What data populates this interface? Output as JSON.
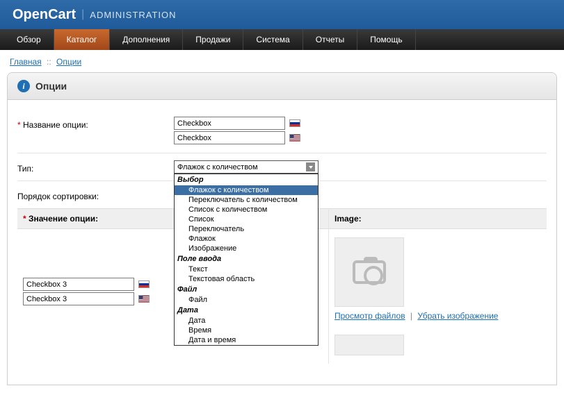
{
  "header": {
    "logo": "OpenCart",
    "sub": "ADMINISTRATION"
  },
  "menu": {
    "items": [
      "Обзор",
      "Каталог",
      "Дополнения",
      "Продажи",
      "Система",
      "Отчеты",
      "Помощь"
    ],
    "active_index": 1
  },
  "breadcrumb": {
    "home": "Главная",
    "current": "Опции"
  },
  "panel": {
    "title": "Опции"
  },
  "form": {
    "name_label": "Название опции:",
    "name_ru": "Checkbox",
    "name_en": "Checkbox",
    "type_label": "Тип:",
    "type_selected": "Флажок с количеством",
    "sort_label": "Порядок сортировки:"
  },
  "dropdown": {
    "groups": [
      {
        "label": "Выбор",
        "options": [
          "Флажок с количеством",
          "Переключатель с количеством",
          "Список с количеством",
          "Список",
          "Переключатель",
          "Флажок",
          "Изображение"
        ]
      },
      {
        "label": "Поле ввода",
        "options": [
          "Текст",
          "Текстовая область"
        ]
      },
      {
        "label": "Файл",
        "options": [
          "Файл"
        ]
      },
      {
        "label": "Дата",
        "options": [
          "Дата",
          "Время",
          "Дата и время"
        ]
      }
    ],
    "selected": "Флажок с количеством"
  },
  "values": {
    "heading_left": "Значение опции:",
    "heading_right": "Image:",
    "name_ru": "Checkbox 3",
    "name_en": "Checkbox 3",
    "browse": "Просмотр файлов",
    "clear": "Убрать изображение"
  }
}
